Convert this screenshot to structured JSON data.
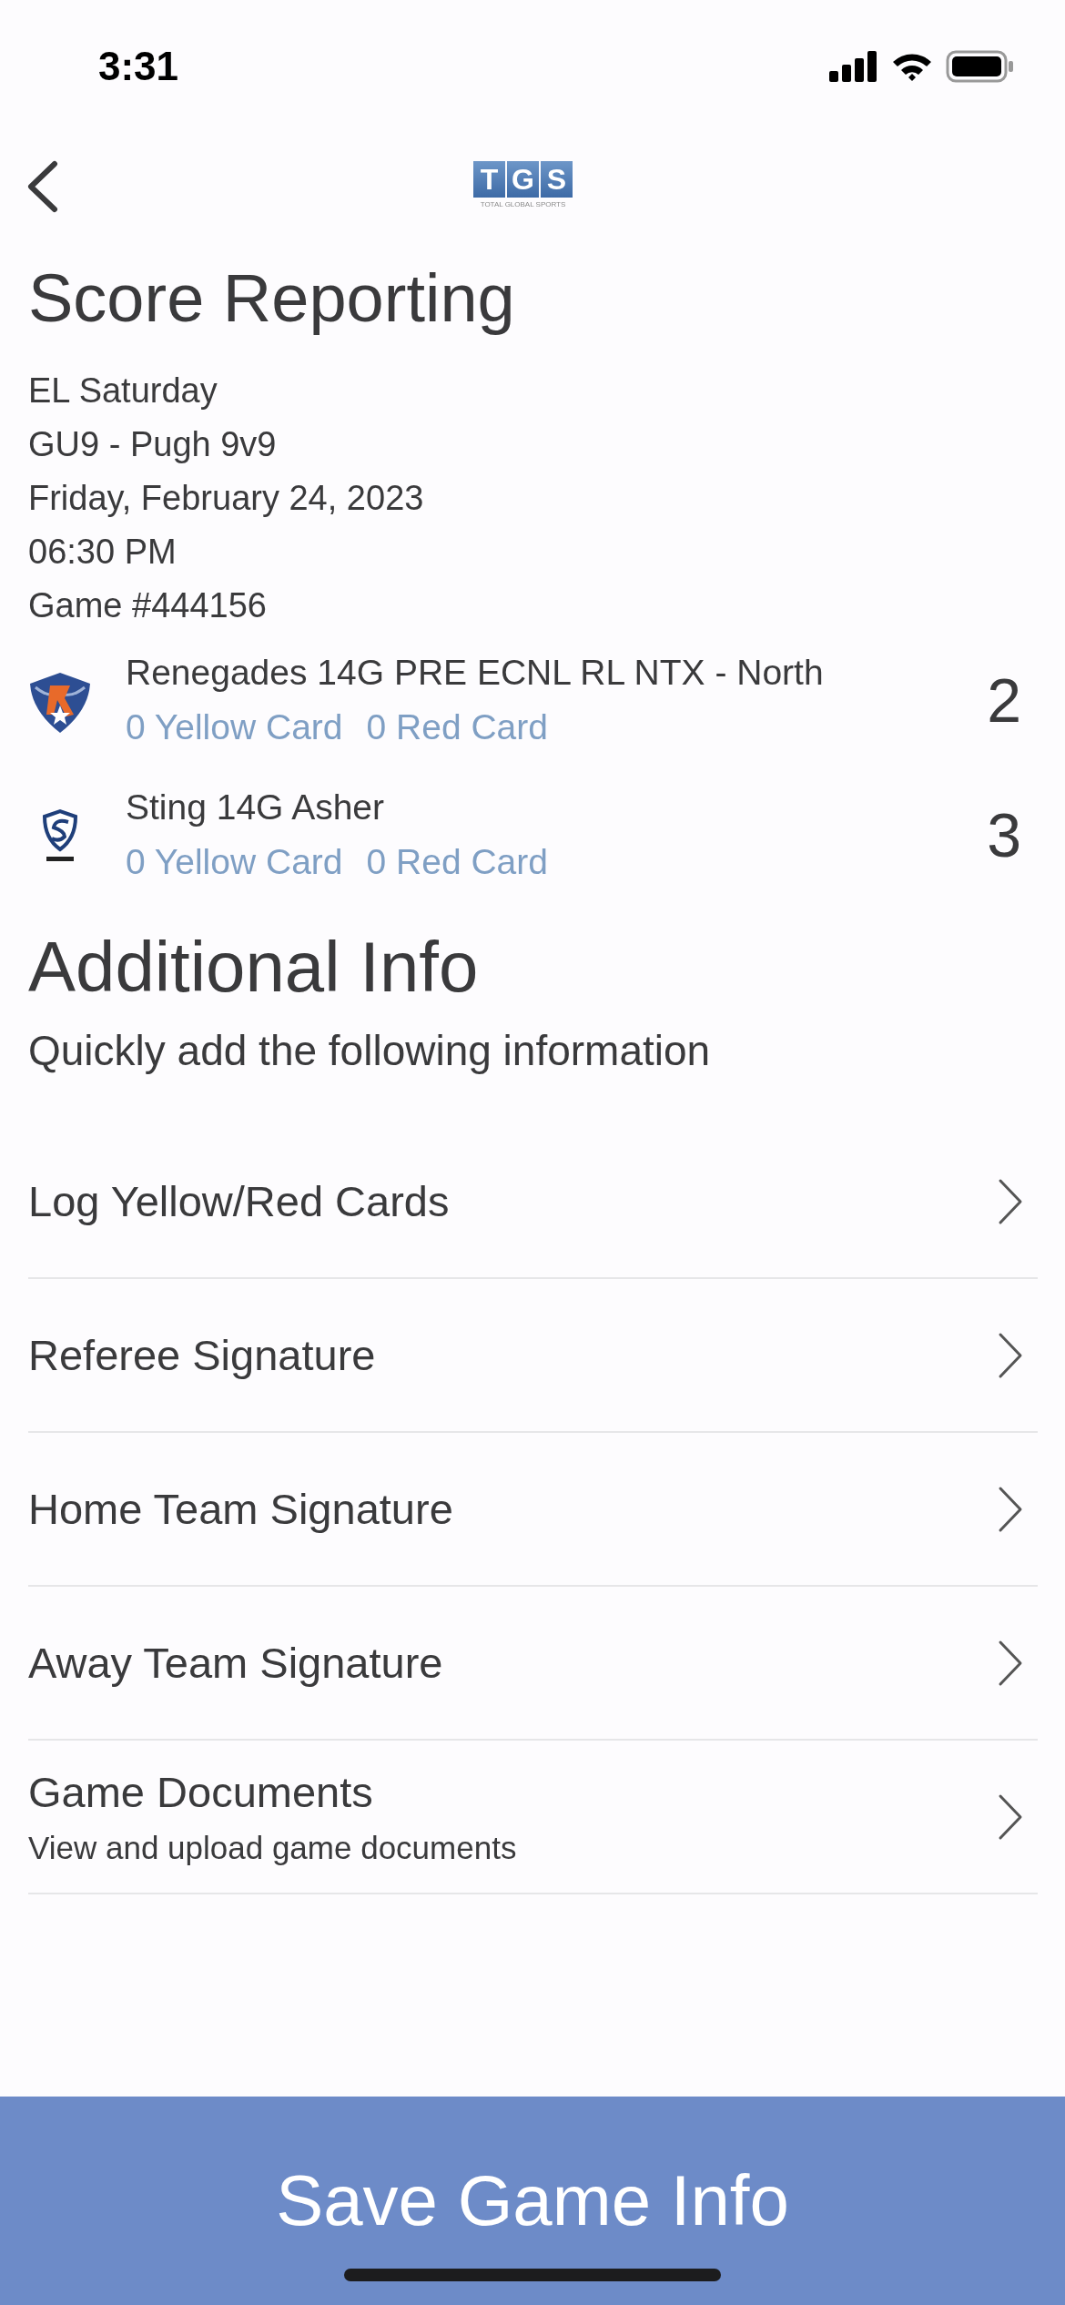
{
  "status_bar": {
    "time": "3:31"
  },
  "header": {
    "logo": {
      "letters": [
        "T",
        "G",
        "S"
      ],
      "caption": "TOTAL GLOBAL SPORTS"
    }
  },
  "title": "Score Reporting",
  "game_info": [
    "EL Saturday",
    "GU9 - Pugh 9v9",
    "Friday, February 24, 2023",
    "06:30 PM",
    "Game #444156"
  ],
  "teams": [
    {
      "kind": "winged-shield",
      "name": "Renegades 14G PRE ECNL RL NTX - North",
      "yellow_cards": "0 Yellow Card",
      "red_cards": "0 Red Card",
      "score": "2"
    },
    {
      "kind": "outline-shield",
      "name": "Sting 14G Asher",
      "yellow_cards": "0 Yellow Card",
      "red_cards": "0 Red Card",
      "score": "3"
    }
  ],
  "additional_info": {
    "title": "Additional Info",
    "subtitle": "Quickly add the following information",
    "items": [
      {
        "label": "Log Yellow/Red Cards"
      },
      {
        "label": "Referee Signature"
      },
      {
        "label": "Home Team Signature"
      },
      {
        "label": "Away Team Signature"
      },
      {
        "label": "Game Documents",
        "description": "View and upload game documents"
      }
    ]
  },
  "save_button": "Save Game Info"
}
